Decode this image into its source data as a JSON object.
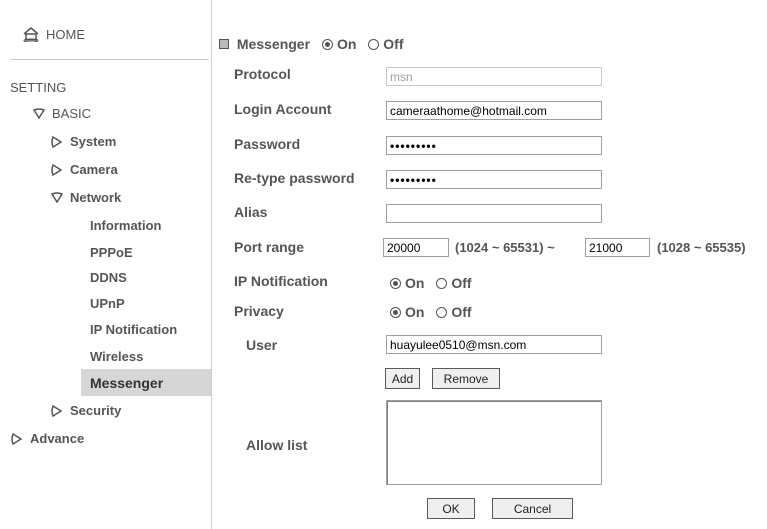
{
  "sidebar": {
    "home": "HOME",
    "setting": "SETTING",
    "basic": "BASIC",
    "system": "System",
    "camera": "Camera",
    "network": "Network",
    "network_items": [
      "Information",
      "PPPoE",
      "DDNS",
      "UPnP",
      "IP Notification",
      "Wireless",
      "Messenger"
    ],
    "security": "Security",
    "advance": "Advance",
    "active_item": "Messenger"
  },
  "messenger": {
    "title": "Messenger",
    "on": "On",
    "off": "Off",
    "selected": "On"
  },
  "form": {
    "protocol_label": "Protocol",
    "protocol_value": "msn",
    "login_label": "Login Account",
    "login_value": "cameraathome@hotmail.com",
    "password_label": "Password",
    "password_value": "•••••••••",
    "retype_label": "Re-type password",
    "retype_value": "•••••••••",
    "alias_label": "Alias",
    "alias_value": "",
    "port_label": "Port range",
    "port_from": "20000",
    "port_from_range": "(1024 ~ 65531) ~",
    "port_to": "21000",
    "port_to_range": "(1028 ~ 65535)",
    "ipnotif_label": "IP Notification",
    "ipnotif_on": "On",
    "ipnotif_off": "Off",
    "ipnotif_selected": "On",
    "privacy_label": "Privacy",
    "privacy_on": "On",
    "privacy_off": "Off",
    "privacy_selected": "On",
    "user_label": "User",
    "user_value": "huayulee0510@msn.com",
    "add_button": "Add",
    "remove_button": "Remove",
    "allow_label": "Allow list",
    "ok_button": "OK",
    "cancel_button": "Cancel"
  }
}
